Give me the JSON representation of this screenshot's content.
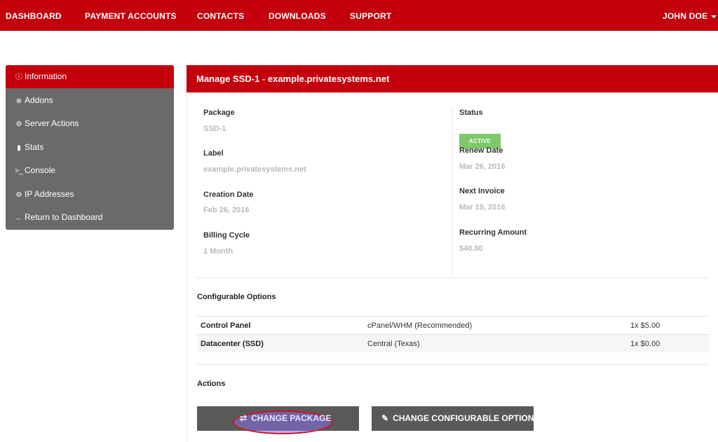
{
  "nav": {
    "dashboard": "DASHBOARD",
    "payment_accounts": "PAYMENT ACCOUNTS",
    "contacts": "CONTACTS",
    "downloads": "DOWNLOADS",
    "support": "SUPPORT",
    "user": "JOHN DOE"
  },
  "sidebar": {
    "items": [
      {
        "label": "Information",
        "icon": "info-icon"
      },
      {
        "label": "Addons",
        "icon": "plus-circle-icon"
      },
      {
        "label": "Server Actions",
        "icon": "gears-icon"
      },
      {
        "label": "Stats",
        "icon": "bar-chart-icon"
      },
      {
        "label": "Console",
        "icon": "terminal-icon"
      },
      {
        "label": "IP Addresses",
        "icon": "gear-icon"
      },
      {
        "label": "Return to Dashboard",
        "icon": "arrow-left-icon"
      }
    ]
  },
  "panel": {
    "title": "Manage SSD-1 - example.privatesystems.net"
  },
  "details": {
    "package_label": "Package",
    "package_value": "SSD-1",
    "label_label": "Label",
    "label_value": "example.privatesystems.net",
    "creation_label": "Creation Date",
    "creation_value": "Feb 26, 2016",
    "billing_label": "Billing Cycle",
    "billing_value": "1 Month",
    "status_label": "Status",
    "status_value": "ACTIVE",
    "renew_label": "Renew Date",
    "renew_value": "Mar 26, 2016",
    "next_invoice_label": "Next Invoice",
    "next_invoice_value": "Mar 19, 2016",
    "recurring_label": "Recurring Amount",
    "recurring_value": "$40.00"
  },
  "configurable": {
    "title": "Configurable Options",
    "rows": [
      {
        "name": "Control Panel",
        "value": "cPanel/WHM (Recommended)",
        "price": "1x $5.00"
      },
      {
        "name": "Datacenter (SSD)",
        "value": "Central (Texas)",
        "price": "1x $0.00"
      }
    ]
  },
  "actions": {
    "title": "Actions",
    "change_package": "CHANGE PACKAGE",
    "change_options": "CHANGE CONFIGURABLE OPTIONS"
  },
  "colors": {
    "brand_red": "#c4000c",
    "sidebar_gray": "#6a6a6a",
    "status_green": "#7cc86a",
    "button_gray": "#595959"
  }
}
